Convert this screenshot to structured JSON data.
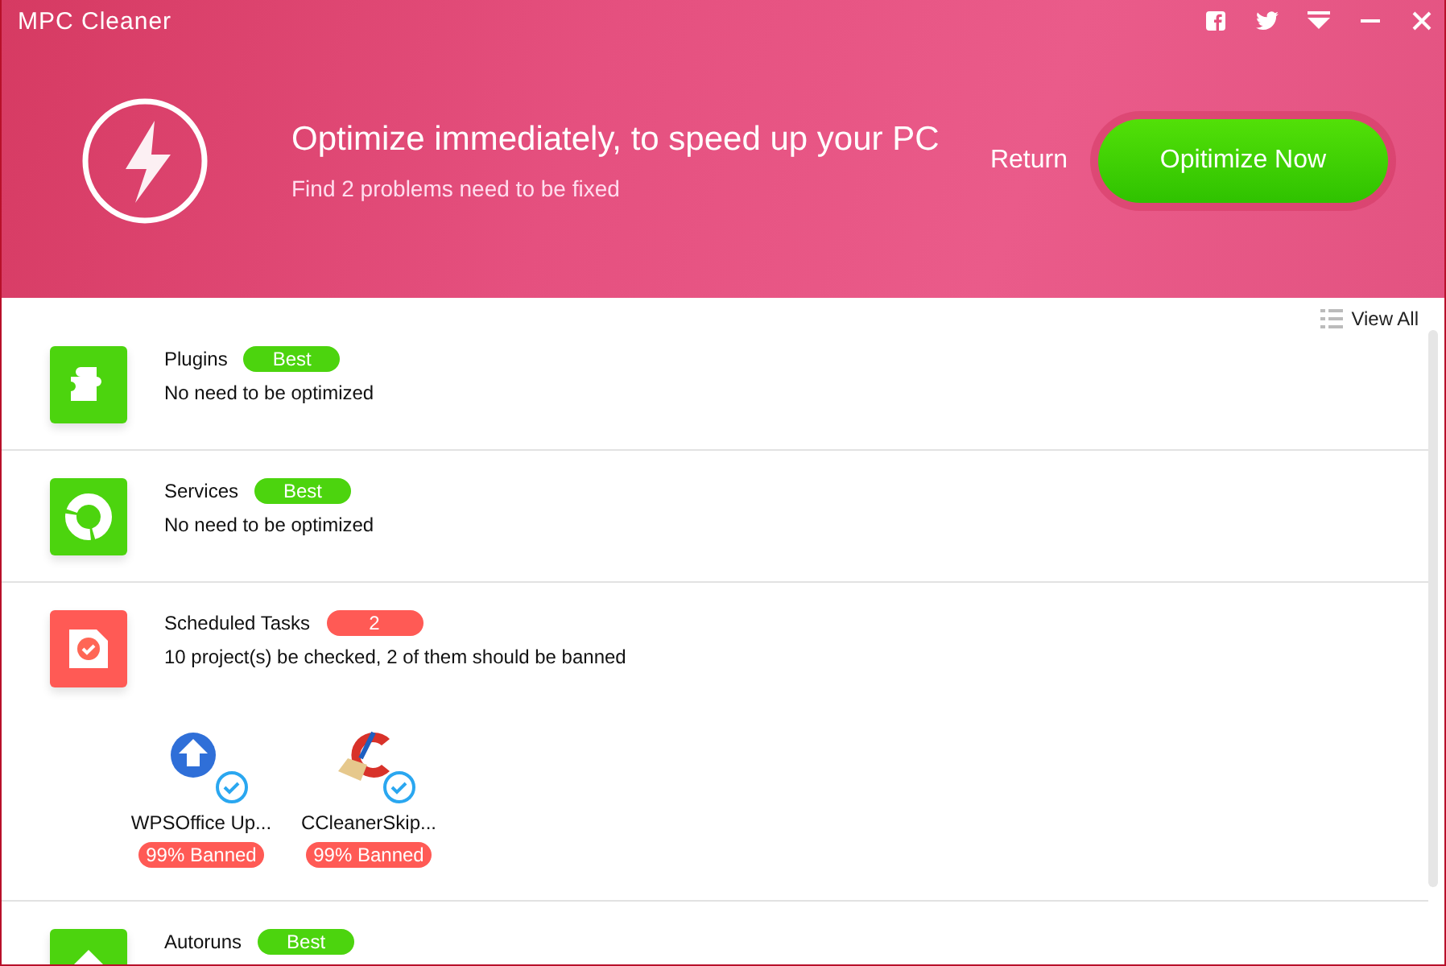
{
  "window": {
    "title": "MPC Cleaner"
  },
  "header": {
    "headline": "Optimize immediately, to speed up your PC",
    "subline": "Find 2 problems need to be fixed",
    "return": "Return",
    "action": "Opitimize Now"
  },
  "view_all": "View All",
  "categories": [
    {
      "kind": "plugins",
      "name": "Plugins",
      "color": "#4cd40e",
      "badge": "Best",
      "description": "No need to be optimized"
    },
    {
      "kind": "services",
      "name": "Services",
      "color": "#4cd40e",
      "badge": "Best",
      "description": "No need to be optimized"
    },
    {
      "kind": "tasks",
      "name": "Scheduled Tasks",
      "color": "#ff5a55",
      "badge": "2",
      "description": "10 project(s) be checked, 2 of them should be banned",
      "items": [
        {
          "kind": "upload",
          "name": "WPSOffice Up...",
          "badge": "99% Banned",
          "checked": true
        },
        {
          "kind": "broom",
          "name": "CCleanerSkip...",
          "badge": "99% Banned",
          "checked": true
        }
      ]
    },
    {
      "kind": "autoruns",
      "name": "Autoruns",
      "color": "#4cd40e",
      "badge": "Best"
    }
  ]
}
